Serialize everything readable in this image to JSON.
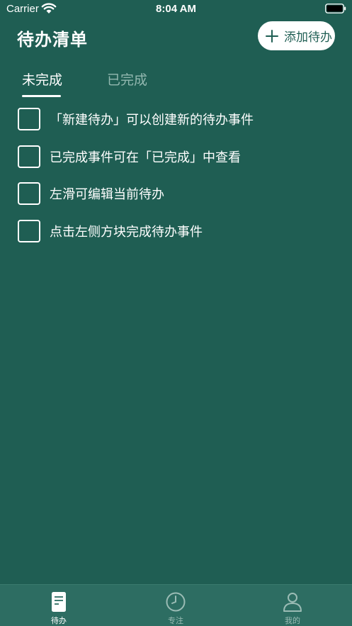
{
  "status_bar": {
    "carrier": "Carrier",
    "time": "8:04 AM"
  },
  "header": {
    "title": "待办清单",
    "add_button_label": "添加待办"
  },
  "tabs": [
    {
      "label": "未完成",
      "active": true
    },
    {
      "label": "已完成",
      "active": false
    }
  ],
  "todos": [
    {
      "text": "「新建待办」可以创建新的待办事件",
      "done": false
    },
    {
      "text": "已完成事件可在「已完成」中查看",
      "done": false
    },
    {
      "text": "左滑可编辑当前待办",
      "done": false
    },
    {
      "text": "点击左侧方块完成待办事件",
      "done": false
    }
  ],
  "tab_bar": {
    "items": [
      {
        "label": "待办",
        "icon": "document-icon",
        "active": true
      },
      {
        "label": "专注",
        "icon": "clock-icon",
        "active": false
      },
      {
        "label": "我的",
        "icon": "person-icon",
        "active": false
      }
    ]
  },
  "colors": {
    "background": "#1f5e53",
    "tab_bar": "#2d6d62",
    "inactive": "#9bbcb5",
    "accent": "#ffffff"
  }
}
